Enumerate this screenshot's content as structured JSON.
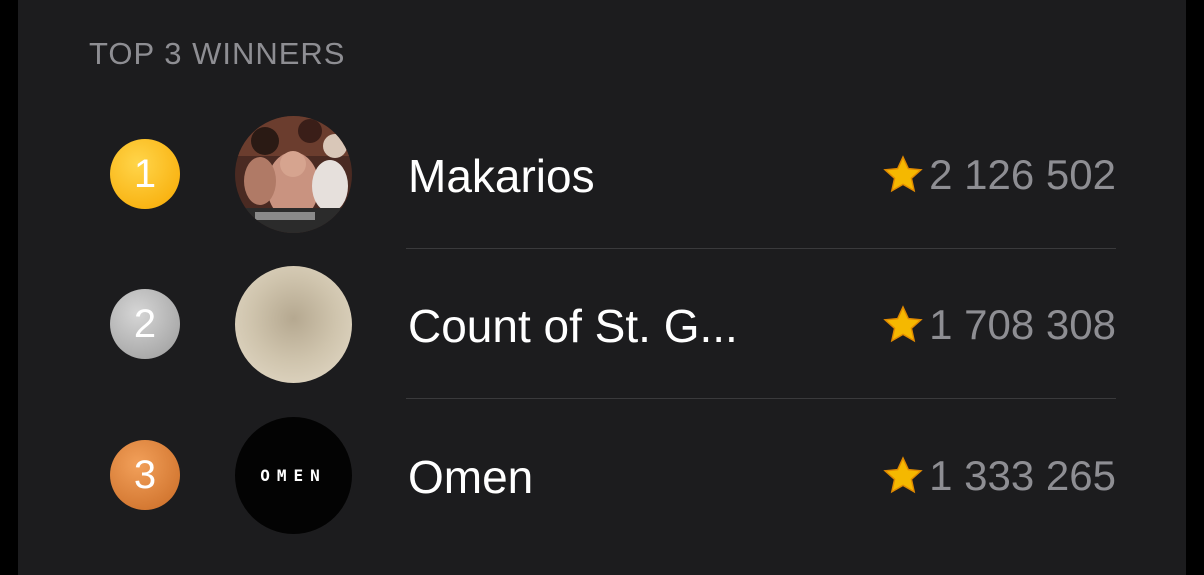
{
  "section": {
    "title": "TOP 3 WINNERS"
  },
  "winners": [
    {
      "rank": "1",
      "name": "Makarios",
      "score": "2 126 502",
      "badge_color": "#f7a800",
      "avatar": "photo-party-avatar"
    },
    {
      "rank": "2",
      "name": "Count of St. G...",
      "score": "1 708 308",
      "badge_color": "#9a9a9a",
      "avatar": "blurred-beige-avatar"
    },
    {
      "rank": "3",
      "name": "Omen",
      "score": "1 333 265",
      "badge_color": "#c96a24",
      "avatar": "omen-logo-avatar",
      "avatar_text": "OMEN"
    }
  ],
  "colors": {
    "background": "#1c1c1e",
    "title": "#8e8e93",
    "name": "#ffffff",
    "score": "#8e8e93",
    "star": "#f5b800"
  }
}
